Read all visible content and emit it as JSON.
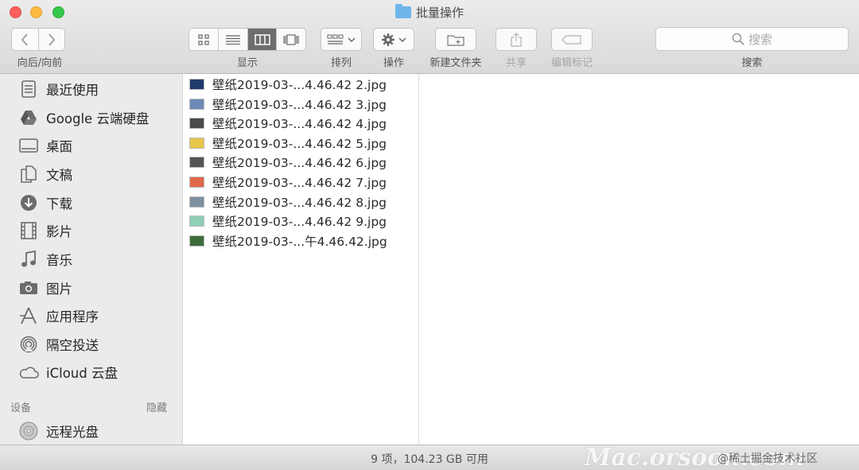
{
  "window": {
    "title": "批量操作"
  },
  "toolbar": {
    "nav_label": "向后/向前",
    "view_label": "显示",
    "sort_label": "排列",
    "action_label": "操作",
    "new_folder_label": "新建文件夹",
    "share_label": "共享",
    "tags_label": "编辑标记",
    "search_placeholder": "搜索",
    "search_label": "搜索"
  },
  "sidebar": {
    "items": [
      {
        "label": "最近使用",
        "icon": "recents-icon"
      },
      {
        "label": "Google 云端硬盘",
        "icon": "google-drive-icon"
      },
      {
        "label": "桌面",
        "icon": "desktop-icon"
      },
      {
        "label": "文稿",
        "icon": "documents-icon"
      },
      {
        "label": "下载",
        "icon": "downloads-icon"
      },
      {
        "label": "影片",
        "icon": "movies-icon"
      },
      {
        "label": "音乐",
        "icon": "music-icon"
      },
      {
        "label": "图片",
        "icon": "pictures-icon"
      },
      {
        "label": "应用程序",
        "icon": "applications-icon"
      },
      {
        "label": "隔空投送",
        "icon": "airdrop-icon"
      },
      {
        "label": "iCloud 云盘",
        "icon": "icloud-icon"
      }
    ],
    "devices_header": "设备",
    "devices_hide": "隐藏",
    "devices": [
      {
        "label": "远程光盘",
        "icon": "remote-disc-icon"
      }
    ]
  },
  "files": [
    {
      "name": "壁纸2019-03-...4.46.42 2.jpg",
      "thumb_color": "#1f3b6b"
    },
    {
      "name": "壁纸2019-03-...4.46.42 3.jpg",
      "thumb_color": "#6d89b8"
    },
    {
      "name": "壁纸2019-03-...4.46.42 4.jpg",
      "thumb_color": "#4a4a4a"
    },
    {
      "name": "壁纸2019-03-...4.46.42 5.jpg",
      "thumb_color": "#e8c64a"
    },
    {
      "name": "壁纸2019-03-...4.46.42 6.jpg",
      "thumb_color": "#555555"
    },
    {
      "name": "壁纸2019-03-...4.46.42 7.jpg",
      "thumb_color": "#e0674a"
    },
    {
      "name": "壁纸2019-03-...4.46.42 8.jpg",
      "thumb_color": "#7e8fa0"
    },
    {
      "name": "壁纸2019-03-...4.46.42 9.jpg",
      "thumb_color": "#8fcfb5"
    },
    {
      "name": "壁纸2019-03-...午4.46.42.jpg",
      "thumb_color": "#3d6b3a"
    }
  ],
  "status": {
    "text": "9 项，104.23 GB 可用",
    "watermark": "Mac.orsoon.com",
    "credit": "@稀土掘金技术社区"
  }
}
